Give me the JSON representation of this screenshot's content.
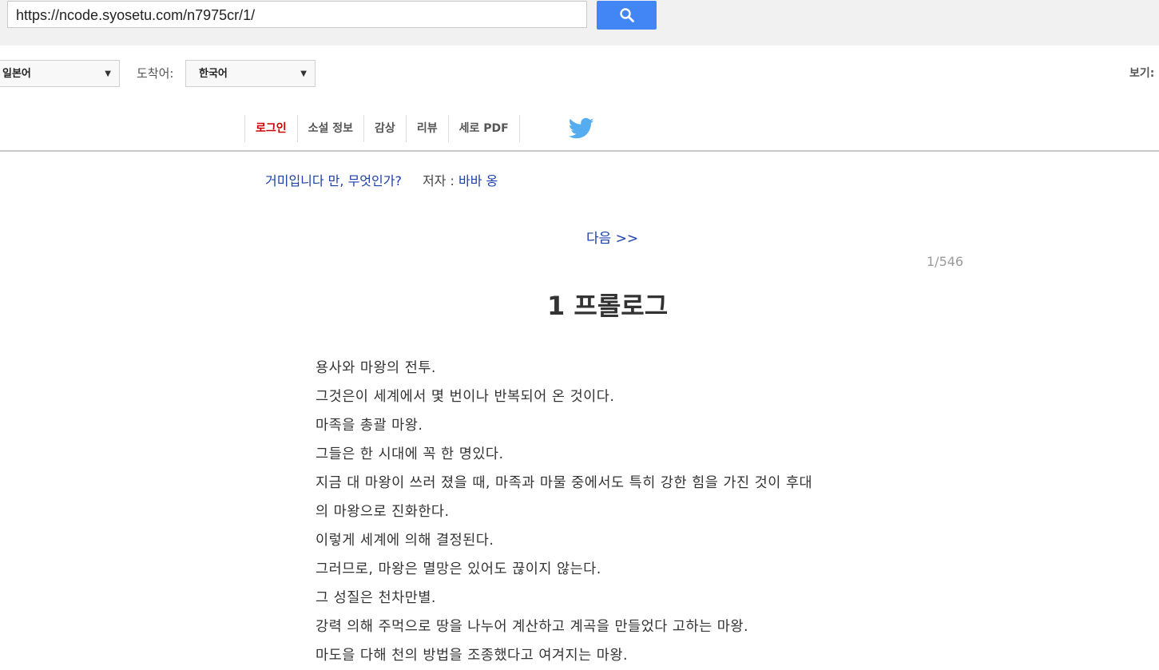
{
  "toolbar": {
    "url": "https://ncode.syosetu.com/n7975cr/1/",
    "search_icon": "search-icon"
  },
  "lang": {
    "source": "일본어",
    "to_label": "도착어:",
    "target": "한국어",
    "view_label": "보기:"
  },
  "nav": {
    "items": [
      "로그인",
      "소설 정보",
      "감상",
      "리뷰",
      "세로 PDF"
    ],
    "twitter_icon": "twitter-icon"
  },
  "novel": {
    "title": "거미입니다 만, 무엇인가?",
    "author_label": "저자 : ",
    "author_name": "바바 옹",
    "next": "다음 >>",
    "page_count": "1/546",
    "chapter_title": "1 프롤로그"
  },
  "body_lines": [
    "용사와 마왕의 전투.",
    "그것은이 세계에서 몇 번이나 반복되어 온 것이다.",
    "마족을 총괄 마왕.",
    "그들은 한 시대에 꼭 한 명있다.",
    "지금 대 마왕이 쓰러 졌을 때, 마족과 마물 중에서도 특히 강한 힘을 가진 것이 후대",
    "의 마왕으로 진화한다.",
    "이렇게 세계에 의해 결정된다.",
    "그러므로, 마왕은 멸망은 있어도 끊이지 않는다.",
    "그 성질은 천차만별.",
    "강력 의해 주먹으로 땅을 나누어 계산하고 계곡을 만들었다 고하는 마왕.",
    "마도을 다해 천의 방법을 조종했다고 여겨지는 마왕."
  ],
  "colors": {
    "link": "#1a3fa8",
    "login": "#cc0000",
    "search_button": "#4285f4",
    "twitter": "#55acee"
  }
}
